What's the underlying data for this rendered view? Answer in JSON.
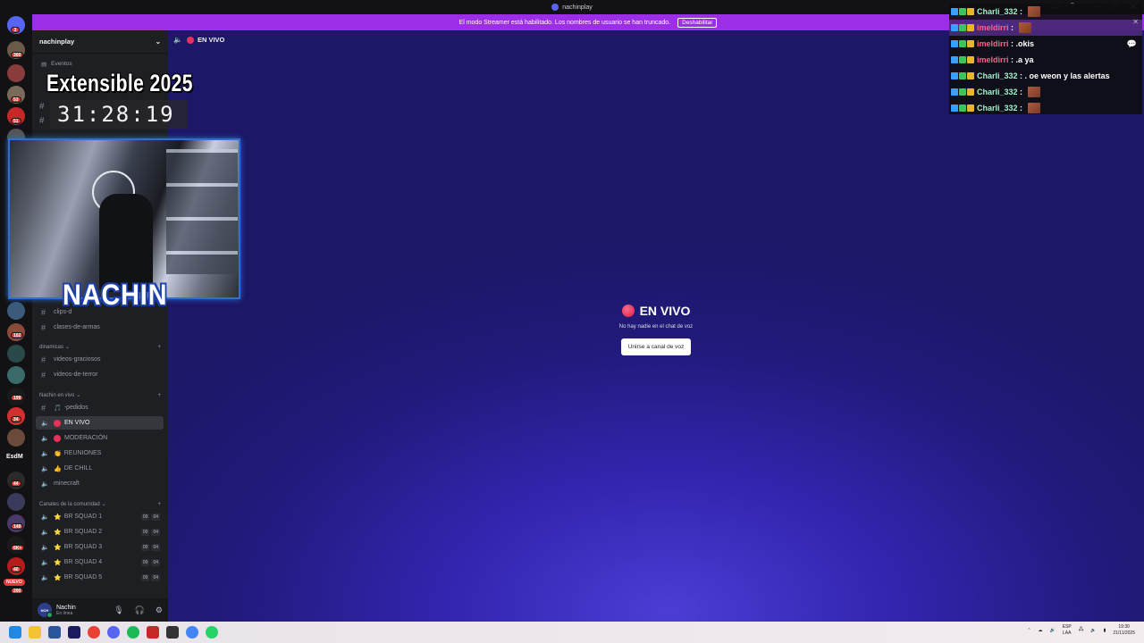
{
  "window": {
    "title": "nachinplay"
  },
  "banner": {
    "text": "El modo Streamer está habilitado. Los nombres de usuario se han truncado.",
    "button": "Deshabilitar"
  },
  "rail": {
    "badges": [
      "3",
      "360",
      "53",
      "51",
      "102",
      "199",
      "34",
      "44",
      "148",
      "6K+",
      "40",
      "200"
    ],
    "esdm": "EsdM",
    "nuevo": "NUEVO"
  },
  "sidebar": {
    "server_name": "nachinplay",
    "eventos": "Eventos",
    "channels_top": [
      {
        "label": "clips-d"
      },
      {
        "label": "clases-de-armas"
      }
    ],
    "cat_dinamicas": "dinamicas",
    "dinamicas": [
      {
        "label": "videos-graciosos"
      },
      {
        "label": "videos-de-terror"
      }
    ],
    "cat_vivo": "Nachin en vivo",
    "vivo": [
      {
        "emoji": "🎵",
        "label": "-pedidos"
      },
      {
        "label": "EN VIVO"
      },
      {
        "label": "MODERACIÓN"
      },
      {
        "emoji": "👏",
        "label": "REUNIONES"
      },
      {
        "emoji": "👍",
        "label": "DE CHILL"
      },
      {
        "label": "minecraft"
      }
    ],
    "cat_comunidad": "Canales de la comunidad",
    "squads": [
      {
        "label": "BR SQUAD 1",
        "a": "00",
        "b": "04"
      },
      {
        "label": "BR SQUAD 2",
        "a": "00",
        "b": "04"
      },
      {
        "label": "BR SQUAD 3",
        "a": "00",
        "b": "04"
      },
      {
        "label": "BR SQUAD 4",
        "a": "00",
        "b": "04"
      },
      {
        "label": "BR SQUAD 5",
        "a": "00",
        "b": "04"
      }
    ]
  },
  "user": {
    "avatar": "NCH",
    "name": "Nachin",
    "status": "En línea"
  },
  "main": {
    "channel": "EN VIVO",
    "center_title": "EN VIVO",
    "center_sub": "No hay nadie en el chat de voz",
    "join_button": "Unirse a canal de voz"
  },
  "overlay": {
    "title": "Extensible 2025",
    "timer": "31:28:19",
    "cam_name": "NACHIN"
  },
  "chat": [
    {
      "user": "Charli_332",
      "text": "",
      "emote": true,
      "color": "#9ef0c8"
    },
    {
      "user": "imeldirri",
      "text": "",
      "emote": true,
      "color": "#ff5f8c"
    },
    {
      "user": "imeldirri",
      "text": ".okis",
      "emote": false,
      "color": "#ff5f8c"
    },
    {
      "user": "imeldirri",
      "text": ".a ya",
      "emote": false,
      "color": "#ff5f8c"
    },
    {
      "user": "Charli_332",
      "text": ". oe weon y las alertas",
      "emote": false,
      "color": "#9ef0c8"
    },
    {
      "user": "Charli_332",
      "text": "",
      "emote": true,
      "color": "#9ef0c8"
    },
    {
      "user": "Charli_332",
      "text": "",
      "emote": true,
      "color": "#9ef0c8"
    }
  ],
  "tray": {
    "lang1": "ESP",
    "lang2": "LAA",
    "time": "19:30",
    "date": "21/11/2025"
  },
  "colors": {
    "banner": "#9b2ee6",
    "accent": "#5865f2",
    "live_dot": "#e8305a"
  }
}
